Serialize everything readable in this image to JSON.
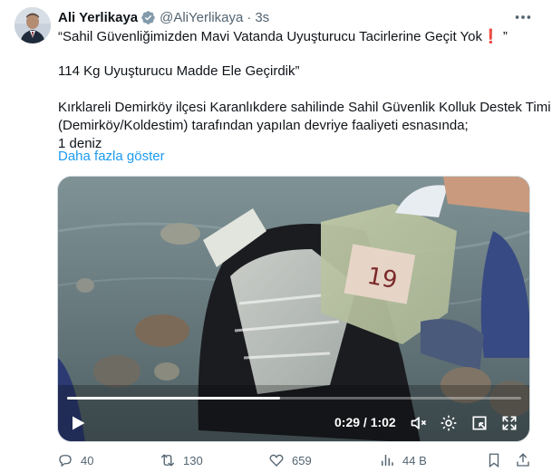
{
  "author": {
    "name": "Ali Yerlikaya",
    "handle": "@AliYerlikaya",
    "separator": "·",
    "time": "3s"
  },
  "tweet": {
    "line1": "“Sahil Güvenliğimizden Mavi Vatanda Uyuşturucu Tacirlerine Geçit Yok",
    "line1_emoji": "❗",
    "line1_end": " ”",
    "line2": "114 Kg Uyuşturucu Madde Ele Geçirdik”",
    "line3": "Kırklareli Demirköy ilçesi Karanlıkdere sahilinde Sahil Güvenlik Kolluk Destek Timi",
    "line4": "(Demirköy/Koldestim) tarafından yapılan devriye faaliyeti esnasında;",
    "line5": "1 deniz",
    "show_more": "Daha fazla göster"
  },
  "video": {
    "current_time": "0:29",
    "duration": "1:02",
    "time_readout": "0:29 / 1:02",
    "progress": 0.47,
    "bag_label": "19"
  },
  "actions": {
    "replies": "40",
    "retweets": "130",
    "likes": "659",
    "views": "44 B"
  },
  "colors": {
    "accent": "#1d9bf0",
    "text": "#0f1419",
    "muted": "#536471",
    "verified": "#829aab"
  },
  "icons": [
    "verified-badge-icon",
    "more-icon",
    "play-icon",
    "volume-icon",
    "settings-icon",
    "minimize-icon",
    "fullscreen-icon",
    "reply-icon",
    "retweet-icon",
    "like-icon",
    "views-icon",
    "bookmark-icon",
    "share-icon"
  ]
}
